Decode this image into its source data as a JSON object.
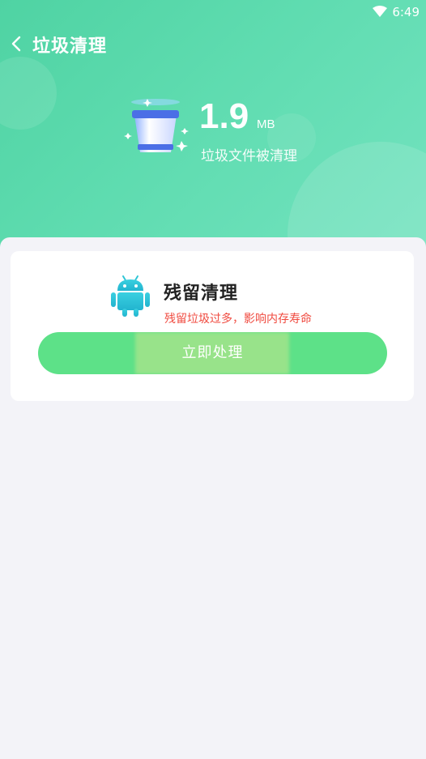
{
  "status_bar": {
    "time": "6:49",
    "wifi_icon": "wifi-icon"
  },
  "nav": {
    "title": "垃圾清理",
    "back_icon": "chevron-left-icon"
  },
  "summary": {
    "size_value": "1.9",
    "size_unit": "MB",
    "description": "垃圾文件被清理",
    "icon": "trash-bucket-icon"
  },
  "card": {
    "icon": "android-icon",
    "title": "残留清理",
    "warning": "残留垃圾过多，影响内存寿命",
    "button_label": "立即处理"
  },
  "colors": {
    "header_gradient_start": "#4fd3a3",
    "header_gradient_end": "#74e3c0",
    "button_green": "#5de188",
    "warning_red": "#f04a3f",
    "android_teal": "#2fc6d6",
    "page_background": "#f3f3f8"
  }
}
